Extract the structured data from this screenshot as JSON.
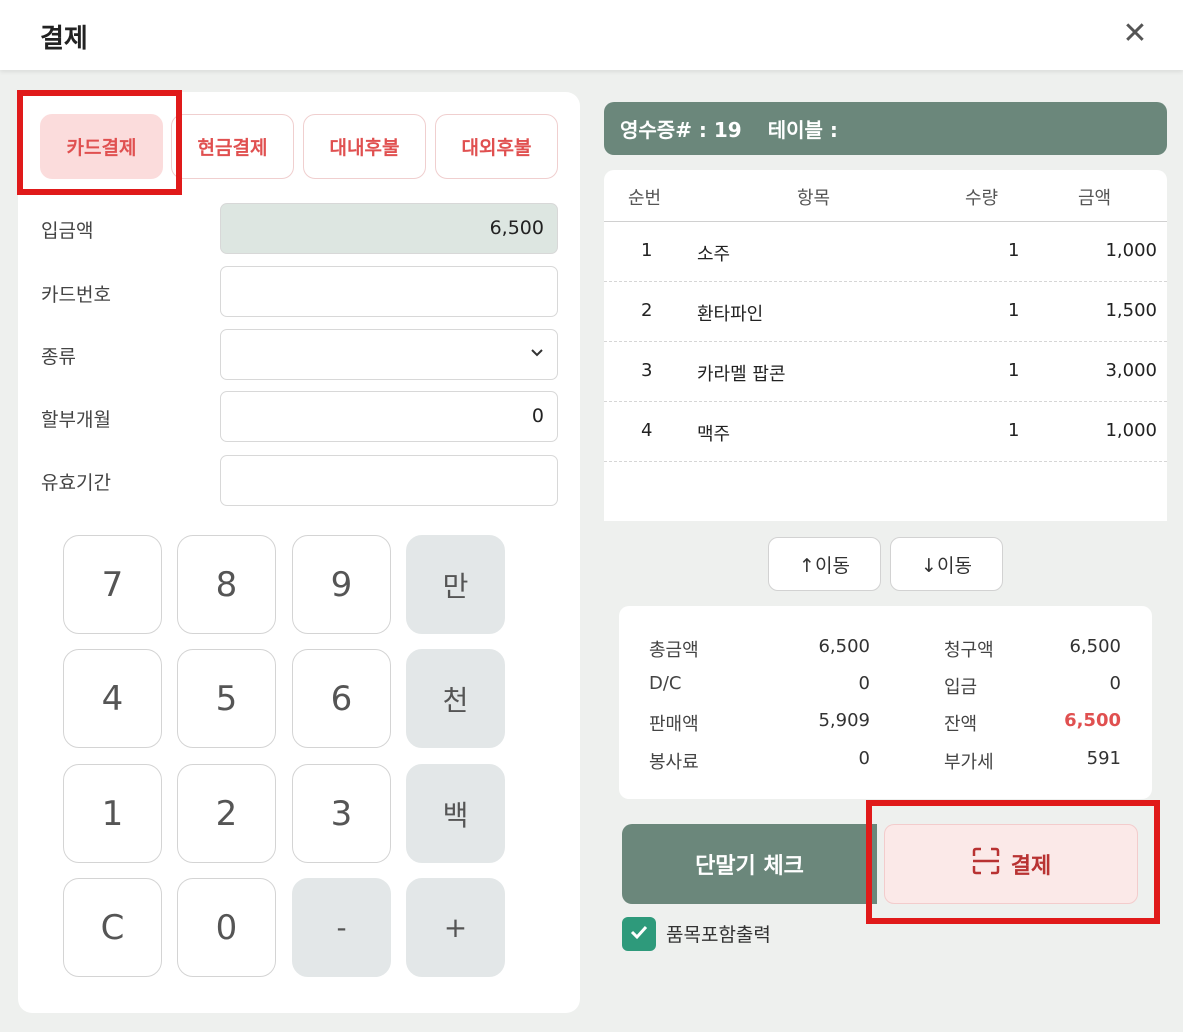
{
  "header": {
    "title": "결제",
    "close_icon": "close-icon"
  },
  "tabs": [
    {
      "label": "카드결제",
      "active": true
    },
    {
      "label": "현금결제",
      "active": false
    },
    {
      "label": "대내후불",
      "active": false
    },
    {
      "label": "대외후불",
      "active": false
    }
  ],
  "form": {
    "amount_label": "입금액",
    "amount_value": "6,500",
    "card_number_label": "카드번호",
    "card_number_value": "",
    "type_label": "종류",
    "type_value": "",
    "installment_label": "할부개월",
    "installment_value": "0",
    "expiry_label": "유효기간",
    "expiry_value": ""
  },
  "keypad": {
    "k7": "7",
    "k8": "8",
    "k9": "9",
    "man": "만",
    "k4": "4",
    "k5": "5",
    "k6": "6",
    "cheon": "천",
    "k1": "1",
    "k2": "2",
    "k3": "3",
    "baek": "백",
    "clear": "C",
    "k0": "0",
    "minus": "-",
    "plus": "+"
  },
  "receipt": {
    "number_text": "영수증# : 19",
    "table_text": "테이블 :"
  },
  "table": {
    "headers": {
      "seq": "순번",
      "item": "항목",
      "qty": "수량",
      "price": "금액"
    },
    "rows": [
      {
        "seq": "1",
        "item": "소주",
        "qty": "1",
        "price": "1,000"
      },
      {
        "seq": "2",
        "item": "환타파인",
        "qty": "1",
        "price": "1,500"
      },
      {
        "seq": "3",
        "item": "카라멜 팝콘",
        "qty": "1",
        "price": "3,000"
      },
      {
        "seq": "4",
        "item": "맥주",
        "qty": "1",
        "price": "1,000"
      }
    ]
  },
  "move": {
    "up_label": "↑이동",
    "down_label": "↓이동"
  },
  "summary": {
    "total_label": "총금액",
    "total_value": "6,500",
    "billed_label": "청구액",
    "billed_value": "6,500",
    "dc_label": "D/C",
    "dc_value": "0",
    "deposit_label": "입금",
    "deposit_value": "0",
    "sales_label": "판매액",
    "sales_value": "5,909",
    "balance_label": "잔액",
    "balance_value": "6,500",
    "service_label": "봉사료",
    "service_value": "0",
    "vat_label": "부가세",
    "vat_value": "591"
  },
  "actions": {
    "terminal_check_label": "단말기 체크",
    "pay_label": "결제",
    "pay_icon": "scan-icon"
  },
  "print_option": {
    "label": "품목포함출력",
    "checked": true
  },
  "colors": {
    "accent_green": "#6b877b",
    "tab_red": "#e05050",
    "highlight_red": "#e01a1a",
    "checkbox_green": "#2e9a7b"
  }
}
